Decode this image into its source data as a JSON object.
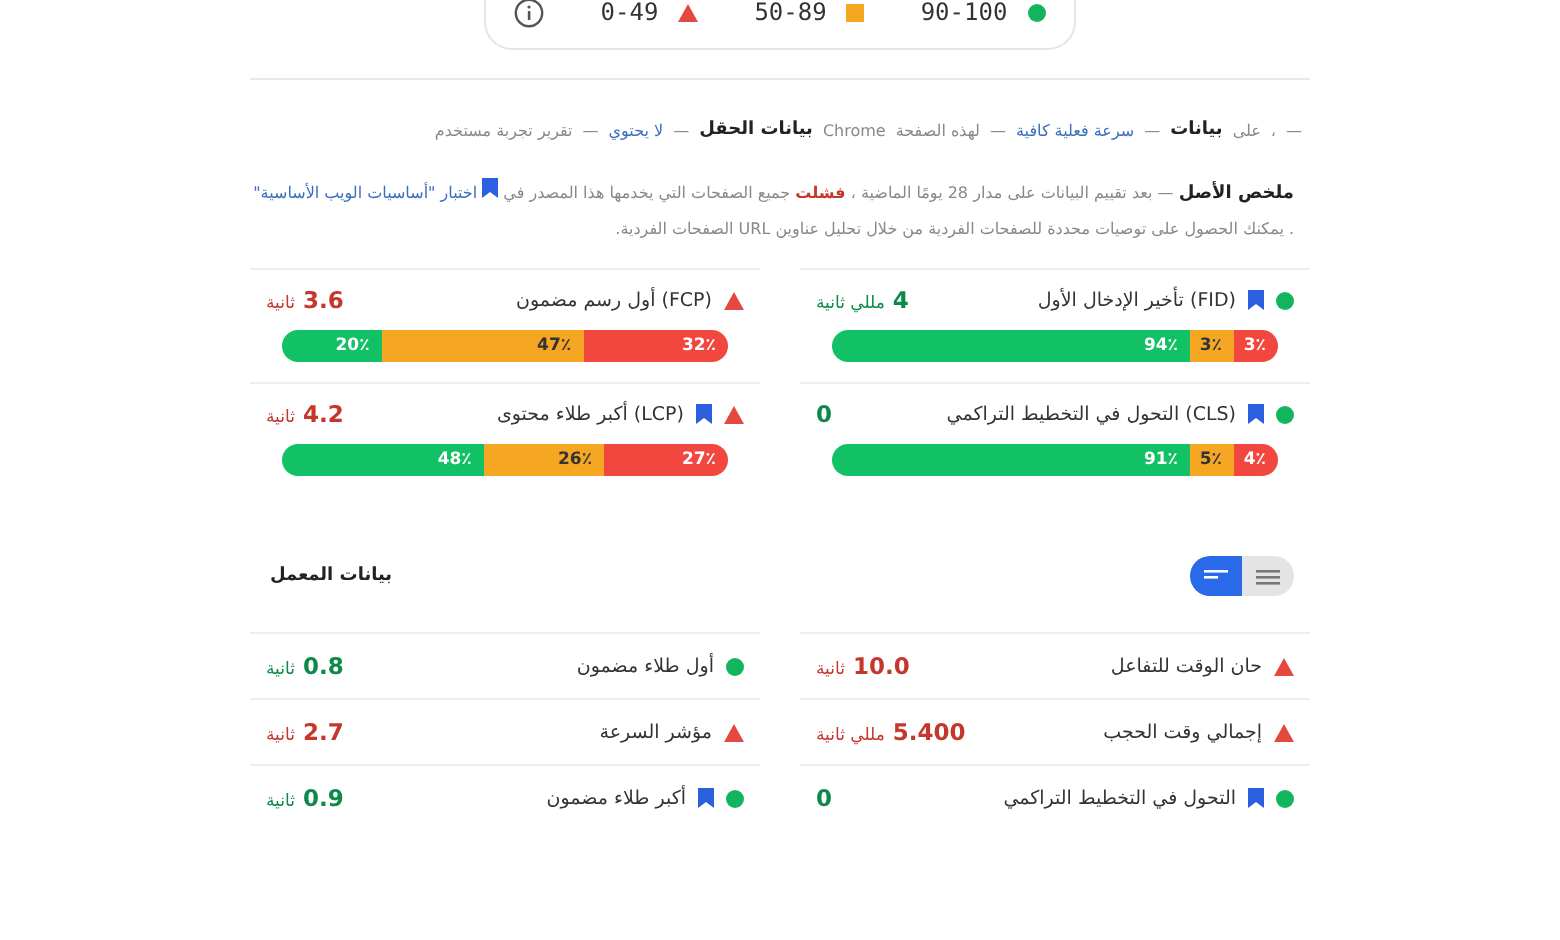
{
  "legend": [
    {
      "kind": "pass",
      "label": "90-100"
    },
    {
      "kind": "average",
      "label": "50-89"
    },
    {
      "kind": "fail",
      "label": "0-49"
    }
  ],
  "breadcrumb": [
    {
      "kind": "plain",
      "text": "—"
    },
    {
      "kind": "plain",
      "text": "،"
    },
    {
      "kind": "plain",
      "text": "على"
    },
    {
      "kind": "bold",
      "text": "بيانات"
    },
    {
      "kind": "plain",
      "text": "—"
    },
    {
      "kind": "link",
      "text": "سرعة فعلية كافية"
    },
    {
      "kind": "plain",
      "text": "—"
    },
    {
      "kind": "plain",
      "text": "لهذه الصفحة"
    },
    {
      "kind": "plain",
      "text": "Chrome"
    },
    {
      "kind": "bold",
      "text": "بيانات الحقل"
    },
    {
      "kind": "plain",
      "text": "—"
    },
    {
      "kind": "link",
      "text": "لا يحتوي"
    },
    {
      "kind": "plain",
      "text": "—"
    },
    {
      "kind": "plain",
      "text": "تقرير تجربة مستخدم"
    }
  ],
  "summary": {
    "parts": [
      {
        "kind": "strong",
        "text": "ملخص الأصل"
      },
      {
        "kind": "plain",
        "text": " — بعد تقييم البيانات على مدار 28 يومًا الماضية ، "
      },
      {
        "kind": "fail",
        "text": "فشلت"
      },
      {
        "kind": "plain",
        "text": " جميع الصفحات التي يخدمها هذا المصدر في "
      },
      {
        "kind": "link",
        "text": "اختبار \"أساسيات الويب الأساسية\""
      },
      {
        "kind": "plain",
        "text": " . يمكنك الحصول على توصيات محددة للصفحات الفردية من خلال تحليل عناوين URL الصفحات الفردية."
      }
    ]
  },
  "field_metrics": [
    {
      "name": "(FID) تأخير الإدخال الأول",
      "bookmark": true,
      "value": "4",
      "unit": "مللي ثانية",
      "kind": "pass",
      "distribution": [
        {
          "label": "3٪"
        },
        {
          "label": "3٪"
        },
        {
          "label": "94٪"
        }
      ]
    },
    {
      "name": "(FCP) أول رسم مضمون",
      "bookmark": false,
      "value": "3.6",
      "unit": "ثانية",
      "kind": "fail",
      "distribution": [
        {
          "label": "32٪"
        },
        {
          "label": "47٪"
        },
        {
          "label": "20٪"
        }
      ]
    },
    {
      "name": "(CLS) التحول في التخطيط التراكمي",
      "bookmark": true,
      "value": "0",
      "kind": "pass",
      "distribution": [
        {
          "label": "4٪"
        },
        {
          "label": "5٪"
        },
        {
          "label": "91٪"
        }
      ]
    },
    {
      "name": "(LCP) أكبر طلاء محتوى",
      "bookmark": true,
      "value": "4.2",
      "unit": "ثانية",
      "kind": "fail",
      "distribution": [
        {
          "label": "27٪"
        },
        {
          "label": "26٪"
        },
        {
          "label": "48٪"
        }
      ]
    }
  ],
  "lab": {
    "title": "بيانات المعمل",
    "view_toggle": [
      {
        "selected": true
      },
      {
        "selected": false
      }
    ],
    "metrics": [
      {
        "name": "حان الوقت للتفاعل",
        "bookmark": false,
        "value": "10.0",
        "unit": "ثانية",
        "kind": "fail"
      },
      {
        "name": "أول طلاء مضمون",
        "bookmark": false,
        "value": "0.8",
        "unit": "ثانية",
        "kind": "pass"
      },
      {
        "name": "إجمالي وقت الحجب",
        "bookmark": false,
        "value": "5.400",
        "unit": "مللي ثانية",
        "kind": "fail"
      },
      {
        "name": "مؤشر السرعة",
        "bookmark": false,
        "value": "2.7",
        "unit": "ثانية",
        "kind": "fail"
      },
      {
        "name": "التحول في التخطيط التراكمي",
        "bookmark": true,
        "value": "0",
        "kind": "pass"
      },
      {
        "name": "أكبر طلاء مضمون",
        "bookmark": true,
        "value": "0.9",
        "unit": "ثانية",
        "kind": "pass"
      }
    ]
  }
}
